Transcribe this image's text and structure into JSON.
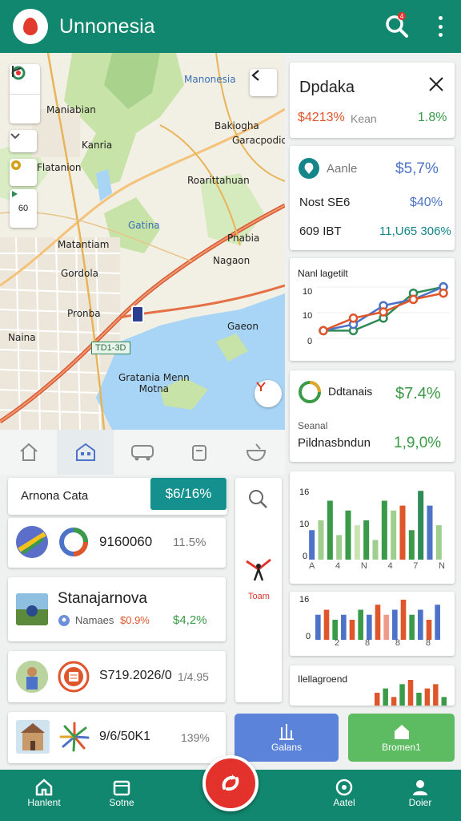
{
  "app": {
    "title": "Unnonesia",
    "notification_badge": "4"
  },
  "map": {
    "labels": [
      {
        "text": "Manonesia",
        "cls": "blue"
      },
      {
        "text": "Maniabian"
      },
      {
        "text": "Bakiogha"
      },
      {
        "text": "Kanria"
      },
      {
        "text": "Garacpodio"
      },
      {
        "text": "Flatanion"
      },
      {
        "text": "Roarittahuan"
      },
      {
        "text": "Gatina",
        "cls": "blue"
      },
      {
        "text": "Matantiam"
      },
      {
        "text": "Pnabia"
      },
      {
        "text": "Gordola"
      },
      {
        "text": "Nagaon"
      },
      {
        "text": "Pronba"
      },
      {
        "text": "Gaeon"
      },
      {
        "text": "Naina"
      },
      {
        "text": "Gratania Menn\nMotna"
      }
    ],
    "route_badge": "TD1-3D",
    "zoom_label": "60"
  },
  "icon_tabs": [
    "home-outline-icon",
    "home-icon",
    "bus-icon",
    "bag-icon",
    "bowl-icon"
  ],
  "list": {
    "header_title": "Arnona Cata",
    "header_button": "$6/16%",
    "items": [
      {
        "title": "9160060",
        "pct": "11.5%"
      },
      {
        "title": "Stanajarnova",
        "sub": "Namaes",
        "sub_val": "$0.9%",
        "pct": "$4,2%"
      },
      {
        "title": "S719.2026/0",
        "pct": "1/4.95"
      },
      {
        "title": "9/6/50K1",
        "pct": "139%"
      }
    ]
  },
  "side_panel": {
    "label": "Toam"
  },
  "right": {
    "header": {
      "title": "Dpdaka",
      "value": "$4213%",
      "unit": "Kean",
      "pct": "1.8%"
    },
    "stats": {
      "row1_label": "Aanle",
      "row1_value": "$5,7%",
      "row2_label": "Nost SE6",
      "row2_value": "$40%",
      "row3_label": "609 IBT",
      "row3_value": "11,U65 306%"
    },
    "line_chart": {
      "title": "Nanl lagetilt",
      "ticks": [
        "10",
        "10",
        "0"
      ]
    },
    "highlight": {
      "label": "Ddtanais",
      "value": "$7.4%",
      "sub_label": "Seanal",
      "sub_title": "Pildnasbndun",
      "sub_value": "1,9,0%"
    },
    "bar_chart1": {
      "ticks": [
        "16",
        "10",
        "0"
      ],
      "x_labels": [
        "A",
        "4",
        "N",
        "4",
        "7",
        "N"
      ]
    },
    "bar_chart2": {
      "ticks": [
        "16",
        "0"
      ],
      "x_labels": [
        "2",
        "8",
        "8",
        "8"
      ]
    },
    "bar_chart3": {
      "title": "Ilellagroend"
    }
  },
  "actions": [
    {
      "label": "Galans",
      "color": "#5b83d9"
    },
    {
      "label": "Bromen1",
      "color": "#5dbb61"
    }
  ],
  "bottom_nav": [
    {
      "label": "Hanlent"
    },
    {
      "label": "Sotne"
    },
    {
      "label": "Aatel"
    },
    {
      "label": "Doier"
    }
  ],
  "colors": {
    "primary": "#12876f",
    "accent": "#e3312b",
    "teal_btn": "#14918e"
  },
  "chart_data": [
    {
      "type": "line",
      "title": "Nanl lagetilt",
      "y_ticks": [
        "10",
        "10",
        "0"
      ],
      "series": [
        {
          "color": "#2e8b57",
          "values": [
            2,
            2,
            4,
            8,
            9
          ]
        },
        {
          "color": "#4c73c7",
          "values": [
            2,
            3,
            6,
            7,
            9
          ]
        },
        {
          "color": "#e0562b",
          "values": [
            2,
            4,
            5,
            7,
            8
          ]
        }
      ]
    },
    {
      "type": "bar",
      "y_ticks": [
        "16",
        "10",
        "0"
      ],
      "x_labels": [
        "A",
        "4",
        "N",
        "4",
        "7",
        "N"
      ],
      "values": [
        6,
        8,
        12,
        5,
        10,
        7,
        8,
        4,
        12,
        10,
        11,
        6,
        14,
        11,
        7
      ],
      "colors": [
        "#4c73c7",
        "#9fcf8e",
        "#3a9a48",
        "#9fcf8e",
        "#3a9a48",
        "#c9e3b5",
        "#3a9a48",
        "#9fcf8e",
        "#3a9a48",
        "#9fcf8e",
        "#e0562b",
        "#3a9a48",
        "#2e8b57",
        "#4c73c7",
        "#9fcf8e"
      ]
    },
    {
      "type": "bar",
      "y_ticks": [
        "16",
        "0"
      ],
      "x_labels": [
        "2",
        "8",
        "8",
        "8"
      ],
      "values": [
        5,
        6,
        4,
        5,
        4,
        6,
        5,
        7,
        5,
        6,
        8,
        5,
        6,
        4,
        7
      ],
      "colors": [
        "#4c73c7",
        "#e0562b",
        "#3a9a48",
        "#4c73c7",
        "#e0562b",
        "#3a9a48",
        "#4c73c7",
        "#e0562b",
        "#f09a8a",
        "#4c73c7",
        "#e0562b",
        "#3a9a48",
        "#4c73c7",
        "#e0562b",
        "#4c73c7"
      ]
    },
    {
      "type": "bar",
      "title": "Ilellagroend",
      "values": [
        3,
        4,
        2,
        5,
        6,
        3,
        4,
        5,
        2
      ],
      "colors": [
        "#e0562b",
        "#3a9a48",
        "#e0562b",
        "#3a9a48",
        "#e0562b",
        "#3a9a48",
        "#e0562b",
        "#e0562b",
        "#3a9a48"
      ]
    }
  ]
}
